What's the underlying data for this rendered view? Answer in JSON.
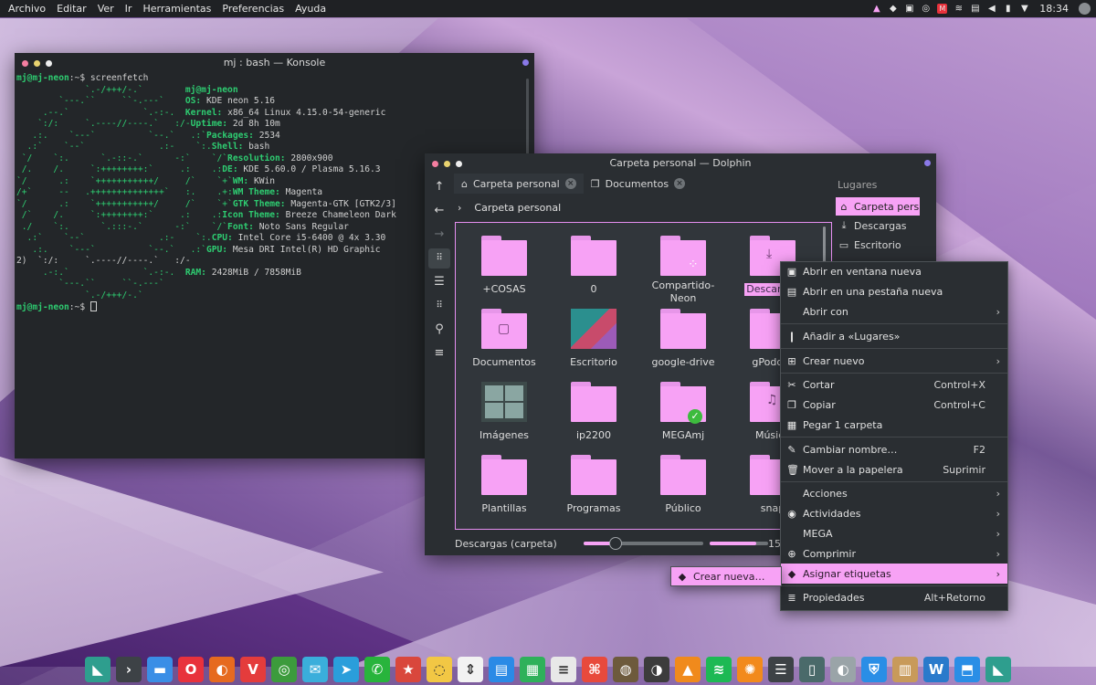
{
  "top_panel": {
    "menu": [
      "Archivo",
      "Editar",
      "Ver",
      "Ir",
      "Herramientas",
      "Preferencias",
      "Ayuda"
    ],
    "tray_icons": [
      "mega-tray-icon",
      "notification-icon",
      "kdeconnect-icon",
      "updates-icon",
      "mega-red-icon",
      "wifi-icon",
      "clipboard-icon",
      "volume-icon",
      "battery-icon",
      "arrow-up-icon"
    ],
    "time": "18:34"
  },
  "konsole": {
    "title": "mj : bash — Konsole",
    "prompt_user": "mj@mj-neon",
    "prompt_path": ":~$ ",
    "command": "screenfetch",
    "ascii_art": [
      "             `.-/+++/-.`",
      "        `---.``     ``-.---`",
      "     .--.`              `.-:-.",
      "    `:/:     `.----//----.`   :/-",
      "   .:.    `---`          `--.`   .:`",
      "  .:`    `--`              .:-    `:.",
      " `/    `:.      `.-::-.`      -:`    `/`",
      " /.    /.     `:++++++++:`     .:    .:",
      "`/      .:    `+++++++++++/     /`    `+`",
      "/+`     --   .++++++++++++++`   :.    .+:",
      "`/      .:    `+++++++++++/     /`    `+`",
      " /`    /.     `:++++++++:`     .:    .:",
      " ./    `:.      `.:::-.`      -:`    `/`",
      "  .:`    `--`              .:-    `:.",
      "   .:.    `---`          `--.`   .:`",
      "    `:/:     `.----//----.`   :/-",
      "     .-:.`              `.-:-.",
      "        `---.``     ``-.---`",
      "             `.-/+++/-.`"
    ],
    "info": [
      {
        "k": "",
        "v": "mj@mj-neon"
      },
      {
        "k": "OS: ",
        "v": "KDE neon 5.16"
      },
      {
        "k": "Kernel: ",
        "v": "x86_64 Linux 4.15.0-54-generic"
      },
      {
        "k": "Uptime: ",
        "v": "2d 8h 10m"
      },
      {
        "k": "Packages: ",
        "v": "2534"
      },
      {
        "k": "Shell: ",
        "v": "bash"
      },
      {
        "k": "Resolution: ",
        "v": "2800x900"
      },
      {
        "k": "DE: ",
        "v": "KDE 5.60.0 / Plasma 5.16.3"
      },
      {
        "k": "WM: ",
        "v": "KWin"
      },
      {
        "k": "WM Theme: ",
        "v": "Magenta"
      },
      {
        "k": "GTK Theme: ",
        "v": "Magenta-GTK [GTK2/3]"
      },
      {
        "k": "Icon Theme: ",
        "v": "Breeze Chameleon Dark"
      },
      {
        "k": "Font: ",
        "v": "Noto Sans Regular"
      },
      {
        "k": "CPU: ",
        "v": "Intel Core i5-6400 @ 4x 3.30"
      },
      {
        "k": "GPU: ",
        "v": "Mesa DRI Intel(R) HD Graphic"
      },
      {
        "k": "",
        "v": ""
      },
      {
        "k": "RAM: ",
        "v": "2428MiB / 7858MiB"
      }
    ],
    "wrap_fragment": "2)"
  },
  "dolphin": {
    "title": "Carpeta personal — Dolphin",
    "tabs": [
      "Carpeta personal",
      "Documentos"
    ],
    "breadcrumb": "Carpeta personal",
    "places_header": "Lugares",
    "places": [
      "Carpeta pers",
      "Descargas",
      "Escritorio"
    ],
    "folders": [
      {
        "label": "+COSAS",
        "kind": "folder"
      },
      {
        "label": "0",
        "kind": "folder"
      },
      {
        "label": "Compartido-Neon",
        "kind": "folder-share"
      },
      {
        "label": "Descargas",
        "kind": "folder-download",
        "selected": true
      },
      {
        "label": "Documentos",
        "kind": "folder-doc"
      },
      {
        "label": "Escritorio",
        "kind": "desktop"
      },
      {
        "label": "google-drive",
        "kind": "folder"
      },
      {
        "label": "gPodder",
        "kind": "folder"
      },
      {
        "label": "Imágenes",
        "kind": "images"
      },
      {
        "label": "ip2200",
        "kind": "folder"
      },
      {
        "label": "MEGAmj",
        "kind": "folder-mega"
      },
      {
        "label": "Música",
        "kind": "folder-music"
      },
      {
        "label": "Plantillas",
        "kind": "folder"
      },
      {
        "label": "Programas",
        "kind": "folder"
      },
      {
        "label": "Público",
        "kind": "folder"
      },
      {
        "label": "snap",
        "kind": "folder"
      }
    ],
    "status_text": "Descargas (carpeta)",
    "zoom_fraction": 0.27,
    "space_fraction": 0.8,
    "status_suffix": "15"
  },
  "context_menu": {
    "items": [
      {
        "icon": "open-window-icon",
        "glyph": "▣",
        "label": "Abrir en ventana nueva",
        "shortcut": "",
        "submenu": false
      },
      {
        "icon": "open-tab-icon",
        "glyph": "▤",
        "label": "Abrir en una pestaña nueva",
        "shortcut": "",
        "submenu": false
      },
      {
        "icon": "",
        "glyph": "",
        "label": "Abrir con",
        "shortcut": "",
        "submenu": true
      },
      {
        "sep": true
      },
      {
        "icon": "bookmark-icon",
        "glyph": "❙",
        "label": "Añadir a «Lugares»",
        "shortcut": "",
        "submenu": false
      },
      {
        "sep": true
      },
      {
        "icon": "create-new-icon",
        "glyph": "⊞",
        "label": "Crear nuevo",
        "shortcut": "",
        "submenu": true
      },
      {
        "sep": true
      },
      {
        "icon": "cut-icon",
        "glyph": "✂",
        "label": "Cortar",
        "shortcut": "Control+X",
        "submenu": false
      },
      {
        "icon": "copy-icon",
        "glyph": "❐",
        "label": "Copiar",
        "shortcut": "Control+C",
        "submenu": false
      },
      {
        "icon": "paste-icon",
        "glyph": "▦",
        "label": "Pegar 1 carpeta",
        "shortcut": "",
        "submenu": false
      },
      {
        "sep": true
      },
      {
        "icon": "rename-icon",
        "glyph": "✎",
        "label": "Cambiar nombre…",
        "shortcut": "F2",
        "submenu": false
      },
      {
        "icon": "trash-icon",
        "glyph": "🗑",
        "label": "Mover a la papelera",
        "shortcut": "Suprimir",
        "submenu": false
      },
      {
        "sep": true
      },
      {
        "icon": "",
        "glyph": "",
        "label": "Acciones",
        "shortcut": "",
        "submenu": true
      },
      {
        "icon": "activities-icon",
        "glyph": "◉",
        "label": "Actividades",
        "shortcut": "",
        "submenu": true
      },
      {
        "icon": "",
        "glyph": "",
        "label": "MEGA",
        "shortcut": "",
        "submenu": true
      },
      {
        "icon": "compress-icon",
        "glyph": "⊕",
        "label": "Comprimir",
        "shortcut": "",
        "submenu": true
      },
      {
        "icon": "tag-icon",
        "glyph": "◆",
        "label": "Asignar etiquetas",
        "shortcut": "",
        "submenu": true,
        "highlighted": true
      },
      {
        "sep": true
      },
      {
        "icon": "properties-icon",
        "glyph": "≣",
        "label": "Propiedades",
        "shortcut": "Alt+Retorno",
        "submenu": false
      }
    ],
    "submenu_item": "Crear nueva…"
  },
  "taskbar": {
    "apps": [
      {
        "name": "kde-neon-icon",
        "bg": "#2e9e8e",
        "glyph": "◣"
      },
      {
        "name": "terminal-icon",
        "bg": "#3d4246",
        "glyph": "›"
      },
      {
        "name": "files-icon",
        "bg": "#3a8ee6",
        "glyph": "▬"
      },
      {
        "name": "opera-icon",
        "bg": "#e8323c",
        "glyph": "O"
      },
      {
        "name": "firefox-icon",
        "bg": "#e66a1f",
        "glyph": "◐"
      },
      {
        "name": "vivaldi-icon",
        "bg": "#e43c3c",
        "glyph": "V"
      },
      {
        "name": "chrome-icon",
        "bg": "#3c9b3c",
        "glyph": "◎"
      },
      {
        "name": "mail-icon",
        "bg": "#3aaedb",
        "glyph": "✉"
      },
      {
        "name": "telegram-icon",
        "bg": "#2a9edb",
        "glyph": "➤"
      },
      {
        "name": "whatsapp-icon",
        "bg": "#28b43c",
        "glyph": "✆"
      },
      {
        "name": "bookmark-app-icon",
        "bg": "#d9473c",
        "glyph": "★"
      },
      {
        "name": "idea-icon",
        "bg": "#f2c744",
        "glyph": "◌"
      },
      {
        "name": "transfer-icon",
        "bg": "#f2f2f2",
        "glyph": "⇕"
      },
      {
        "name": "writer-icon",
        "bg": "#2a8ae6",
        "glyph": "▤"
      },
      {
        "name": "calc-icon",
        "bg": "#2eb15a",
        "glyph": "▦"
      },
      {
        "name": "notes-icon",
        "bg": "#e8e8e8",
        "glyph": "≡"
      },
      {
        "name": "pdf-icon",
        "bg": "#e84a3c",
        "glyph": "⌘"
      },
      {
        "name": "gimp-icon",
        "bg": "#6d5a3c",
        "glyph": "◍"
      },
      {
        "name": "linux-icon",
        "bg": "#3c3c3c",
        "glyph": "◑"
      },
      {
        "name": "vlc-icon",
        "bg": "#f08a1c",
        "glyph": "▲"
      },
      {
        "name": "spotify-icon",
        "bg": "#1db954",
        "glyph": "≋"
      },
      {
        "name": "orange-icon",
        "bg": "#f28a1c",
        "glyph": "✺"
      },
      {
        "name": "mixer-icon",
        "bg": "#3d4246",
        "glyph": "☰"
      },
      {
        "name": "window-icon",
        "bg": "#4a6a6a",
        "glyph": "▯"
      },
      {
        "name": "screenshot-icon",
        "bg": "#9aa4a8",
        "glyph": "◐"
      },
      {
        "name": "shield-icon",
        "bg": "#2a8ee6",
        "glyph": "⛨"
      },
      {
        "name": "archive-icon",
        "bg": "#c89a5a",
        "glyph": "▥"
      },
      {
        "name": "monitor-icon",
        "bg": "#2a7acb",
        "glyph": "W"
      },
      {
        "name": "store-icon",
        "bg": "#2a8ee6",
        "glyph": "⬒"
      },
      {
        "name": "kde-neon-2-icon",
        "bg": "#2e9e8e",
        "glyph": "◣"
      }
    ]
  }
}
